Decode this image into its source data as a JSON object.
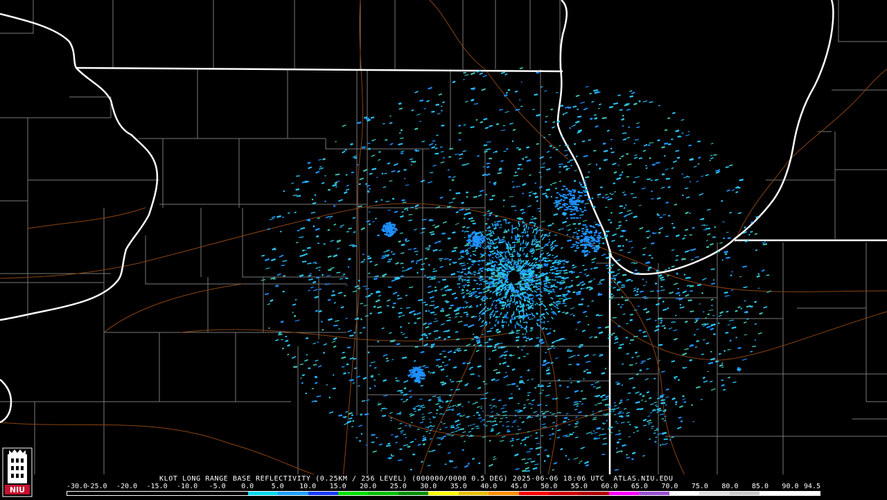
{
  "product": {
    "caption": "KLOT LONG RANGE BASE REFLECTIVITY (0.25KM / 256 LEVEL) (000000/0000 0.5 DEG) 2025-06-06 18:06 UTC  ATLAS.NIU.EDU"
  },
  "logo": {
    "text": "NIU",
    "icon": "niu-tower-logo",
    "accent": "#c8102e"
  },
  "colors": {
    "background": "#000000",
    "state_border": "#ffffff",
    "county_line": "#7a7a7a",
    "highway": "#8b4513",
    "echo_light": "#29c5f6",
    "echo_medium": "#1e90ff",
    "echo_teal": "#3fbfb0"
  },
  "legend": {
    "ticks": [
      "-30.0",
      "-25.0",
      "-20.0",
      "-15.0",
      "-10.0",
      "-5.0",
      "0.0",
      "5.0",
      "10.0",
      "15.0",
      "20.0",
      "25.0",
      "30.0",
      "35.0",
      "40.0",
      "45.0",
      "50.0",
      "55.0",
      "60.0",
      "65.0",
      "70.0",
      "75.0",
      "80.0",
      "85.0",
      "90.0",
      "94.5"
    ],
    "colors": [
      "#000000",
      "#000000",
      "#000000",
      "#000000",
      "#000000",
      "#000000",
      "#00d8f0",
      "#1fa0ff",
      "#1a3cff",
      "#00e000",
      "#00c000",
      "#009000",
      "#ffff00",
      "#e8c000",
      "#ff9000",
      "#ff0000",
      "#d00000",
      "#b00000",
      "#ff00ff",
      "#9a50d0",
      "#ffffff",
      "#e0e0e0",
      "#c8c8c8",
      "#ffffff",
      "#ffffff"
    ]
  }
}
